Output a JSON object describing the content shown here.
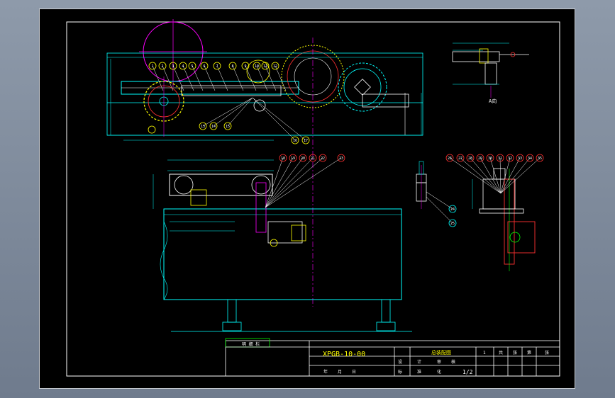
{
  "drawing": {
    "drawing_number": "XPGB-10-00",
    "sheet": "1/2",
    "detail_label": "A向"
  },
  "title_block": {
    "header_cells": [
      "1",
      "共",
      "张",
      "第",
      "张"
    ],
    "product_name": "总装配图",
    "sign_row": [
      "年",
      "月",
      "日"
    ],
    "small_cells": [
      "设",
      "计",
      "审",
      "核",
      "标",
      "准",
      "化"
    ],
    "table_tab": "明 细 栏"
  },
  "balloons": {
    "top_row": [
      "1",
      "2",
      "3",
      "4",
      "5",
      "6",
      "7",
      "8",
      "9",
      "10",
      "11",
      "12"
    ],
    "plan_side": [
      "13",
      "14",
      "15",
      "16",
      "17"
    ],
    "front_row": [
      "18",
      "19",
      "20",
      "21",
      "22",
      "23"
    ],
    "center_col": [
      "24",
      "25"
    ],
    "right_row": [
      "26",
      "27",
      "28",
      "29",
      "30",
      "31",
      "32",
      "33",
      "34",
      "35"
    ]
  },
  "colors": {
    "outline": "#00ffff",
    "border": "#ffffff",
    "centerline": "#ff00ff",
    "gear": "#ffff00",
    "frame": "#ffffff",
    "accent": "#ff0000",
    "part": "#00ff00",
    "balloon": "#ff3030"
  }
}
